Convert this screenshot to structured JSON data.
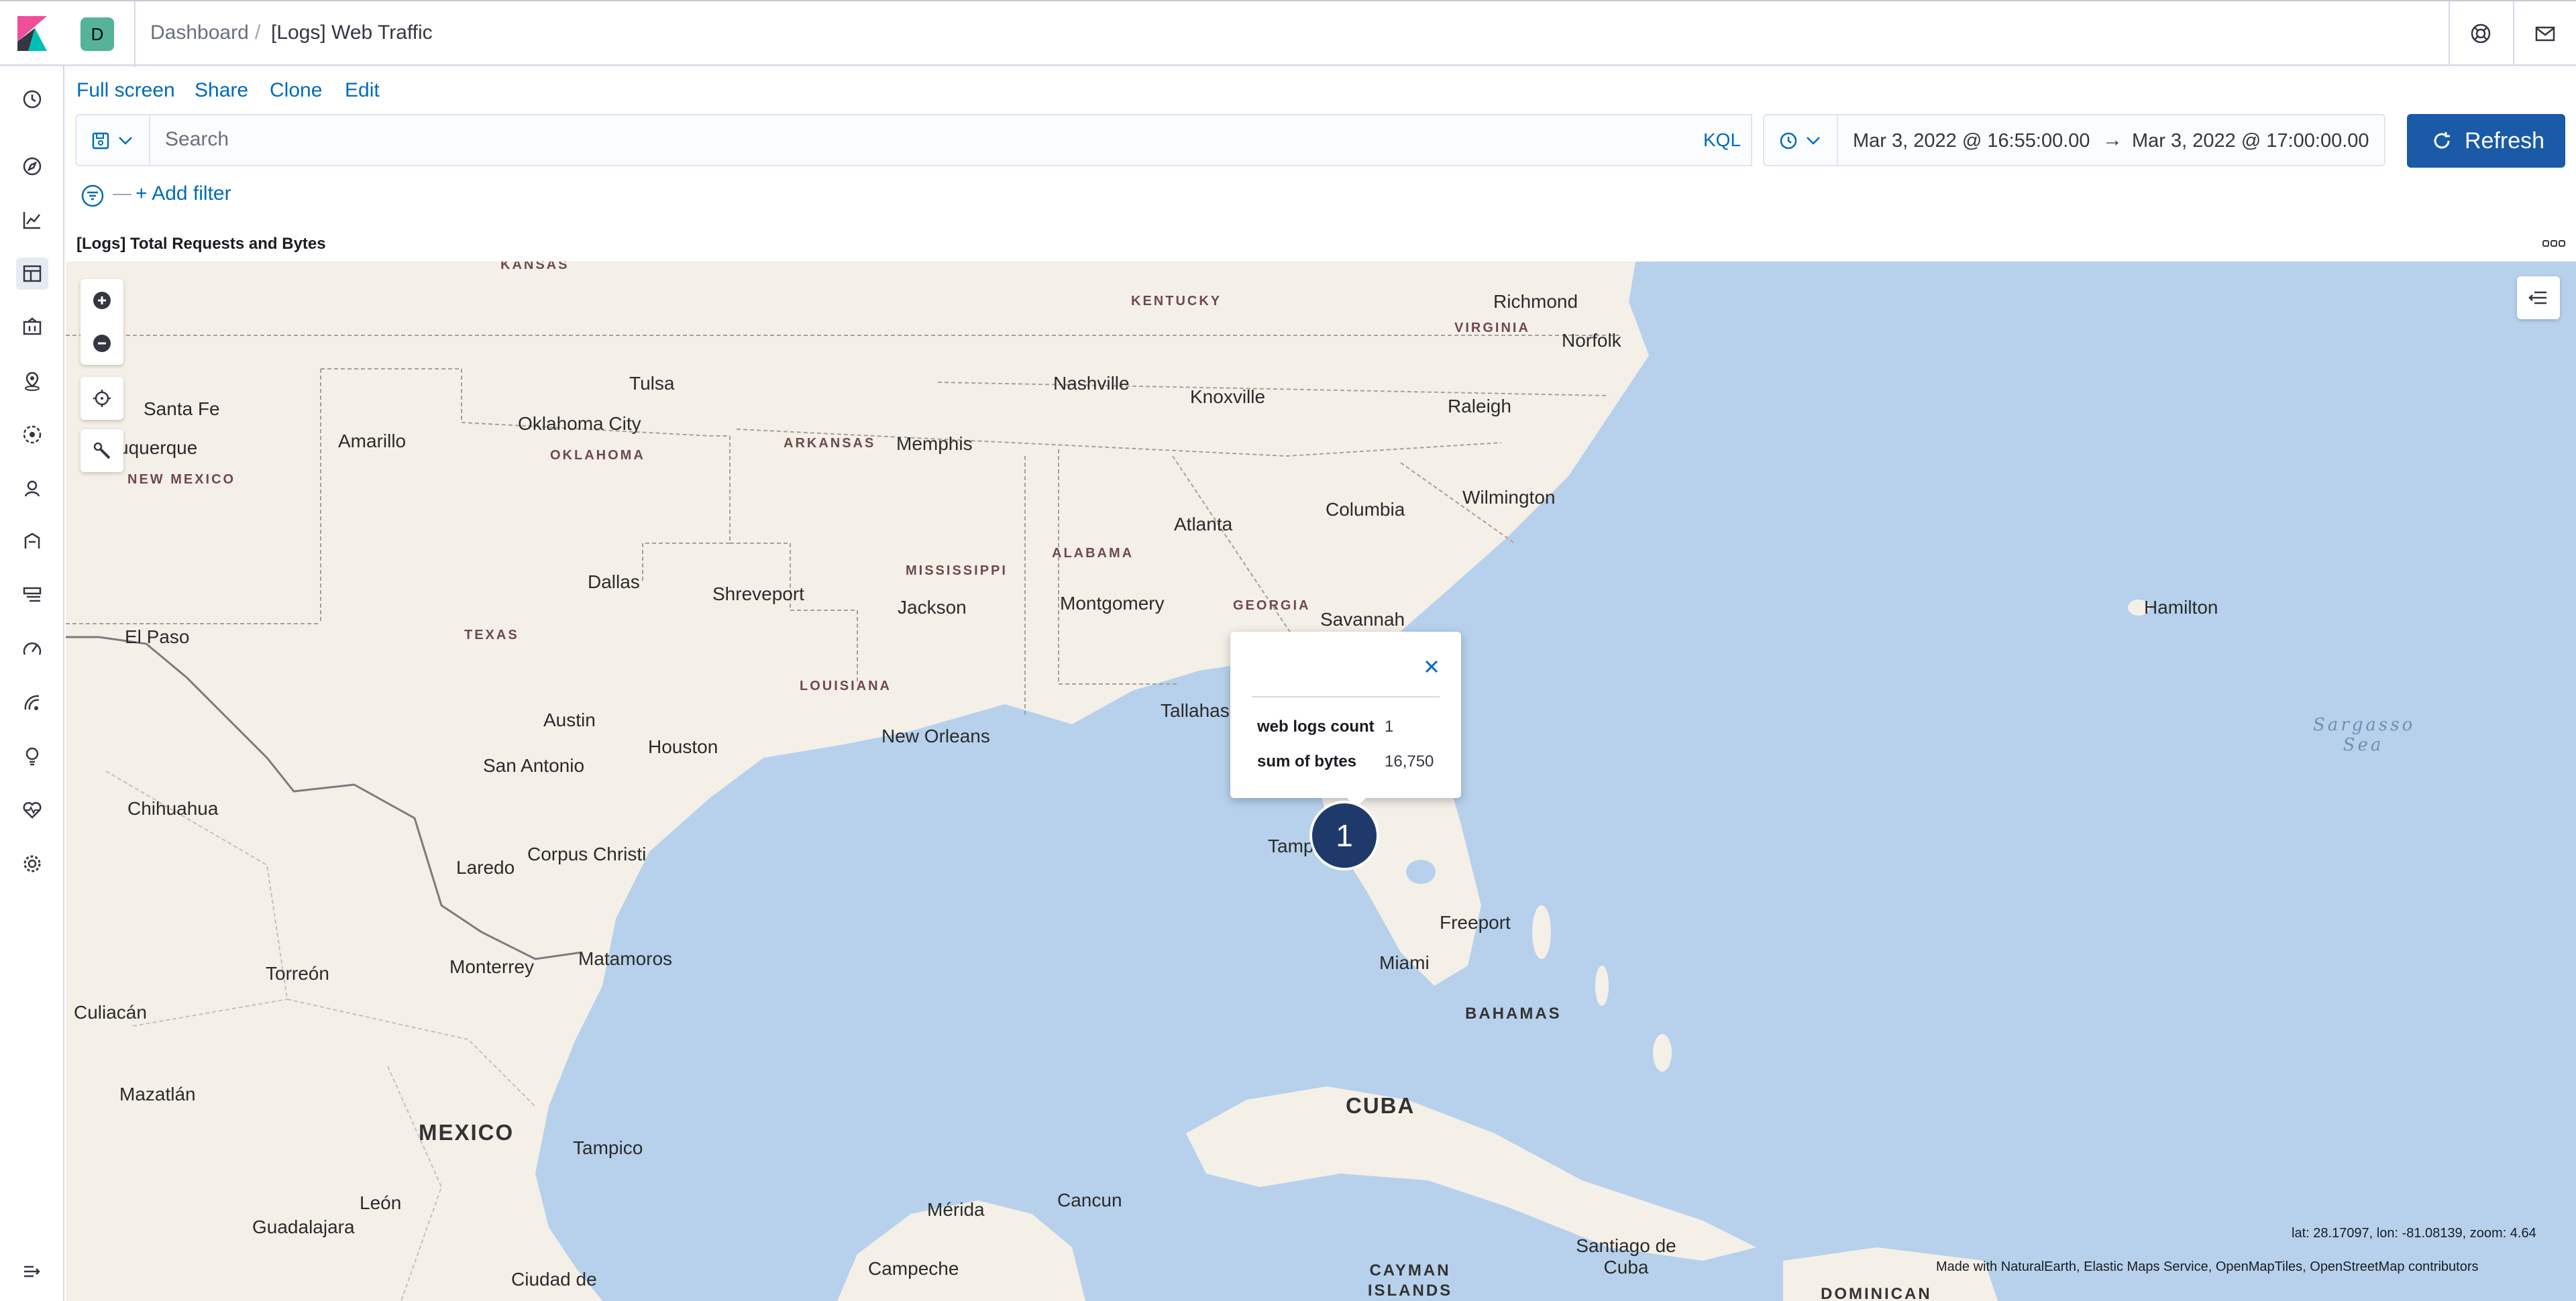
{
  "header": {
    "space_initial": "D",
    "breadcrumbs": [
      "Dashboard",
      "[Logs] Web Traffic"
    ],
    "separator": "/",
    "icons": [
      "help-icon",
      "newsfeed-icon"
    ]
  },
  "nav": {
    "top_links": [
      "Full screen",
      "Share",
      "Clone",
      "Edit"
    ]
  },
  "query": {
    "placeholder": "Search",
    "language": "KQL",
    "date_start": "Mar 3, 2022 @ 16:55:00.00",
    "date_arrow": "→",
    "date_end": "Mar 3, 2022 @ 17:00:00.00",
    "refresh_label": "Refresh",
    "add_filter_label": "+ Add filter",
    "filter_dash": "—"
  },
  "panel": {
    "title": "[Logs] Total Requests and Bytes"
  },
  "map": {
    "labels": {
      "kansas": "KANSAS",
      "kentucky": "KENTUCKY",
      "virginia": "VIRGINIA",
      "richmond": "Richmond",
      "norfolk": "Norfolk",
      "tulsa": "Tulsa",
      "nashville": "Nashville",
      "knoxville": "Knoxville",
      "raleigh": "Raleigh",
      "santa_fe": "Santa Fe",
      "amarillo": "Amarillo",
      "oklahoma_city": "Oklahoma City",
      "oklahoma": "OKLAHOMA",
      "arkansas": "ARKANSAS",
      "memphis": "Memphis",
      "albuquerque": "uquerque",
      "new_mexico": "NEW MEXICO",
      "wilmington": "Wilmington",
      "columbia": "Columbia",
      "atlanta": "Atlanta",
      "mississippi": "MISSISSIPPI",
      "alabama": "ALABAMA",
      "dallas": "Dallas",
      "shreveport": "Shreveport",
      "jackson": "Jackson",
      "montgomery": "Montgomery",
      "georgia": "GEORGIA",
      "savannah": "Savannah",
      "texas": "TEXAS",
      "el_paso": "El Paso",
      "hamilton": "Hamilton",
      "louisiana": "LOUISIANA",
      "tallahassee": "Tallahas",
      "austin": "Austin",
      "houston": "Houston",
      "new_orleans": "New Orleans",
      "san_antonio": "San Antonio",
      "chihuahua": "Chihuahua",
      "tampa": "Tamp",
      "laredo": "Laredo",
      "corpus_christi": "Corpus Christi",
      "freeport": "Freeport",
      "miami": "Miami",
      "matamoros": "Matamoros",
      "monterrey": "Monterrey",
      "torreon": "Torreón",
      "bahamas": "BAHAMAS",
      "culiacan": "Culiacán",
      "mazatlan": "Mazatlán",
      "cuba": "CUBA",
      "mexico": "MEXICO",
      "tampico": "Tampico",
      "cancun": "Cancun",
      "merida": "Mérida",
      "leon": "León",
      "guadalajara": "Guadalajara",
      "santiago": "Santiago de Cuba",
      "campeche": "Campeche",
      "ciudad": "Ciudad de",
      "cayman": "CAYMAN ISLANDS",
      "dominican": "DOMINICAN",
      "sargasso": "Sargasso Sea"
    },
    "tooltip": {
      "rows": [
        {
          "key": "web logs count",
          "value": "1"
        },
        {
          "key": "sum of bytes",
          "value": "16,750"
        }
      ]
    },
    "cluster_count": "1",
    "coords": "lat: 28.17097, lon: -81.08139, zoom: 4.64",
    "attribution": "Made with NaturalEarth, Elastic Maps Service, OpenMapTiles, OpenStreetMap contributors"
  },
  "colors": {
    "accent": "#006bb8",
    "refresh_button": "#1a5aa6",
    "water": "#b7d1ec",
    "land": "#f4f0e8",
    "cluster": "#1f3a6a"
  }
}
